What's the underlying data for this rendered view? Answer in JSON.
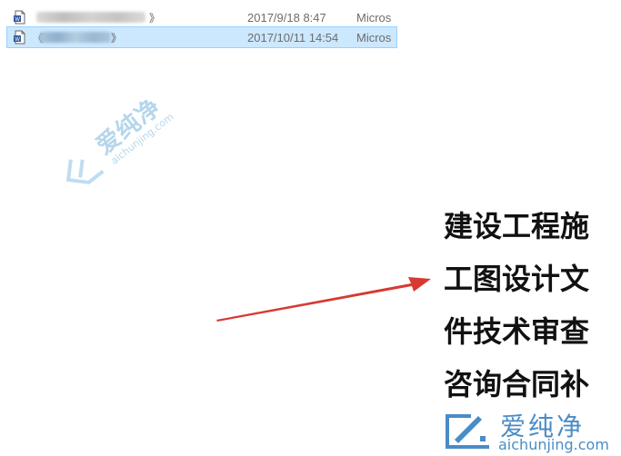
{
  "files": [
    {
      "name_tail": "》",
      "date": "2017/9/18 8:47",
      "type": "Micros",
      "selected": false
    },
    {
      "name_tail": "》",
      "date": "2017/10/11 14:54",
      "type": "Micros",
      "selected": true
    }
  ],
  "watermark": {
    "title": "爱纯净",
    "url": "aichunjing.com"
  },
  "document": {
    "lines": [
      "建设工程施",
      "工图设计文",
      "件技术审查",
      "咨询合同补"
    ]
  },
  "logo": {
    "title": "爱纯净",
    "url": "aichunjing.com"
  },
  "colors": {
    "selection": "#cce8ff",
    "arrow": "#d63a32",
    "brand": "#4a8cc6"
  }
}
